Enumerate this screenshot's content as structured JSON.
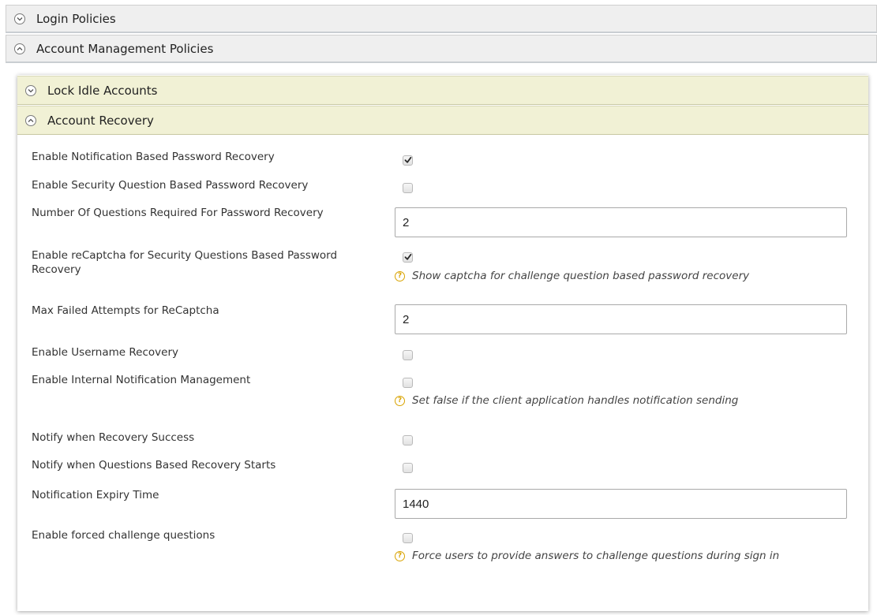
{
  "outer_sections": [
    {
      "label": "Login Policies",
      "expanded": false
    },
    {
      "label": "Account Management Policies",
      "expanded": true
    }
  ],
  "inner_sections": [
    {
      "label": "Lock Idle Accounts",
      "expanded": false
    },
    {
      "label": "Account Recovery",
      "expanded": true
    }
  ],
  "fields": {
    "notification_recovery": {
      "label": "Enable Notification Based Password Recovery",
      "checked": true
    },
    "security_question_recovery": {
      "label": "Enable Security Question Based Password Recovery",
      "checked": false
    },
    "questions_required": {
      "label": "Number Of Questions Required For Password Recovery",
      "value": "2"
    },
    "recaptcha": {
      "label": "Enable reCaptcha for Security Questions Based Password Recovery",
      "checked": true,
      "help": "Show captcha for challenge question based password recovery"
    },
    "max_failed_attempts": {
      "label": "Max Failed Attempts for ReCaptcha",
      "value": "2"
    },
    "username_recovery": {
      "label": "Enable Username Recovery",
      "checked": false
    },
    "internal_notification": {
      "label": "Enable Internal Notification Management",
      "checked": false,
      "help": "Set false if the client application handles notification sending"
    },
    "notify_recovery_success": {
      "label": "Notify when Recovery Success",
      "checked": false
    },
    "notify_questions_start": {
      "label": "Notify when Questions Based Recovery Starts",
      "checked": false
    },
    "notification_expiry": {
      "label": "Notification Expiry Time",
      "value": "1440"
    },
    "forced_challenge": {
      "label": "Enable forced challenge questions",
      "checked": false,
      "help": "Force users to provide answers to challenge questions during sign in"
    }
  },
  "colors": {
    "outer_header_bg": "#efefef",
    "inner_header_bg": "#f1f1d5",
    "help_icon": "#d9a300"
  }
}
